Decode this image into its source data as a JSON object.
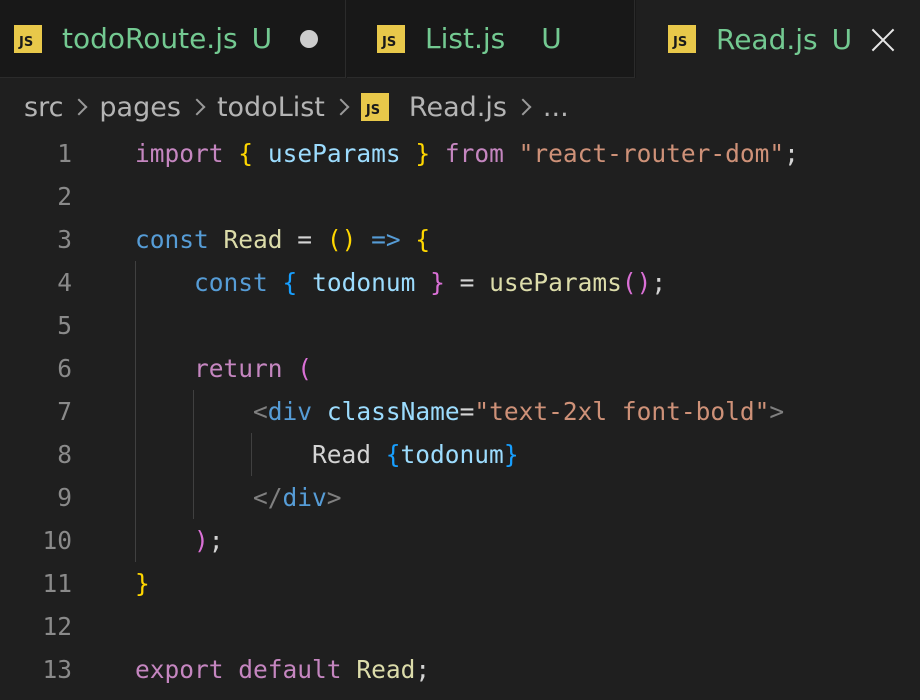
{
  "tabs": [
    {
      "label": "todoRoute.js",
      "icon": "JS",
      "status": "U",
      "dirty": true,
      "active": false
    },
    {
      "label": "List.js",
      "icon": "JS",
      "status": "U",
      "dirty": false,
      "active": false
    },
    {
      "label": "Read.js",
      "icon": "JS",
      "status": "U",
      "dirty": false,
      "active": true
    }
  ],
  "breadcrumb": {
    "segments": [
      "src",
      "pages",
      "todoList"
    ],
    "file_icon": "JS",
    "file": "Read.js",
    "more": "..."
  },
  "editor": {
    "line_numbers": [
      "1",
      "2",
      "3",
      "4",
      "5",
      "6",
      "7",
      "8",
      "9",
      "10",
      "11",
      "12",
      "13"
    ],
    "lines": [
      [
        [
          "import",
          "kw"
        ],
        [
          " ",
          ""
        ],
        [
          "{",
          "br1"
        ],
        [
          " ",
          ""
        ],
        [
          "useParams",
          "var"
        ],
        [
          " ",
          ""
        ],
        [
          "}",
          "br1"
        ],
        [
          " ",
          ""
        ],
        [
          "from",
          "kw"
        ],
        [
          " ",
          ""
        ],
        [
          "\"react-router-dom\"",
          "str"
        ],
        [
          ";",
          "op"
        ]
      ],
      [],
      [
        [
          "const",
          "kwb"
        ],
        [
          " ",
          ""
        ],
        [
          "Read",
          "fn"
        ],
        [
          " = ",
          "op"
        ],
        [
          "()",
          "br1"
        ],
        [
          " ",
          ""
        ],
        [
          "=>",
          "kwb"
        ],
        [
          " ",
          ""
        ],
        [
          "{",
          "br1"
        ]
      ],
      [
        [
          "    ",
          ""
        ],
        [
          "const",
          "kwb"
        ],
        [
          " ",
          ""
        ],
        [
          "{",
          "br3"
        ],
        [
          " ",
          ""
        ],
        [
          "todonum",
          "var"
        ],
        [
          " ",
          ""
        ],
        [
          "}",
          "br2"
        ],
        [
          " = ",
          "op"
        ],
        [
          "useParams",
          "fn"
        ],
        [
          "()",
          "br2"
        ],
        [
          ";",
          "op"
        ]
      ],
      [],
      [
        [
          "    ",
          ""
        ],
        [
          "return",
          "kw"
        ],
        [
          " ",
          ""
        ],
        [
          "(",
          "br2"
        ]
      ],
      [
        [
          "        ",
          ""
        ],
        [
          "<",
          "ang"
        ],
        [
          "div",
          "tag"
        ],
        [
          " ",
          ""
        ],
        [
          "className",
          "attr"
        ],
        [
          "=",
          "op"
        ],
        [
          "\"text-2xl font-bold\"",
          "str"
        ],
        [
          ">",
          "ang"
        ]
      ],
      [
        [
          "            ",
          ""
        ],
        [
          "Read ",
          "txt"
        ],
        [
          "{",
          "br3"
        ],
        [
          "todonum",
          "var"
        ],
        [
          "}",
          "br3"
        ]
      ],
      [
        [
          "        ",
          ""
        ],
        [
          "</",
          "ang"
        ],
        [
          "div",
          "tag"
        ],
        [
          ">",
          "ang"
        ]
      ],
      [
        [
          "    ",
          ""
        ],
        [
          ")",
          "br2"
        ],
        [
          ";",
          "op"
        ]
      ],
      [
        [
          "}",
          "br1"
        ]
      ],
      [],
      [
        [
          "export",
          "kw"
        ],
        [
          " ",
          ""
        ],
        [
          "default",
          "kw"
        ],
        [
          " ",
          ""
        ],
        [
          "Read",
          "fn"
        ],
        [
          ";",
          "op"
        ]
      ]
    ]
  }
}
